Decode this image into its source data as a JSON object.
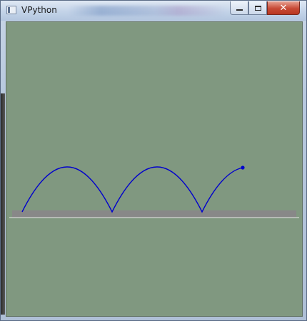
{
  "window": {
    "title": "VPython",
    "controls": {
      "minimize_icon": "minimize-icon",
      "maximize_icon": "maximize-icon",
      "close_icon": "close-icon",
      "close_glyph": "✕"
    }
  },
  "scene": {
    "background_color": "#809880",
    "floor_color": "#888888",
    "trail_color": "#0000cc",
    "ball_color": "#0000cc",
    "horizon_line_color": "#e8e8e8"
  }
}
